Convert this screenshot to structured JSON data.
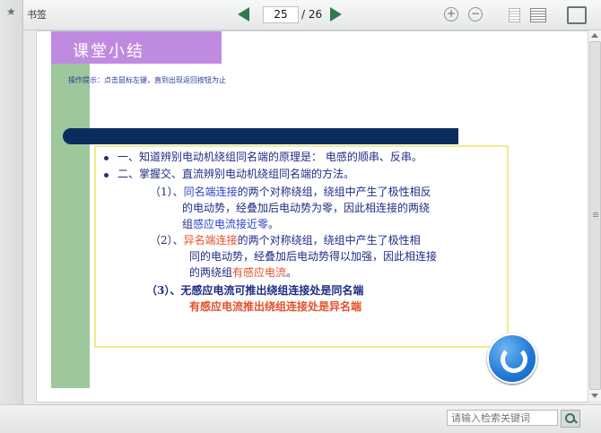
{
  "toolbar": {
    "bookmark_label": "书签",
    "current_page": "25",
    "total_pages": "/ 26",
    "zoom_in": "+",
    "zoom_out": "−"
  },
  "slide": {
    "title": "课堂小结",
    "tip": "操作提示：点击鼠标左键，直到出现返回按钮为止",
    "line1": "一、知道辨别电动机绕组同名端的原理是：    电感的顺串、反串。",
    "line2": "二、掌握交、直流辨别电动机绕组同名端的方法。",
    "p1_prefix": "（1）、",
    "p1_key": "同名端连接",
    "p1_rest": "的两个对称绕组，绕组中产生了极性相反",
    "p1_l2": "的电动势，经叠加后电动势为零，因此相连接的两绕",
    "p1_l3a": "组",
    "p1_l3b": "感应电流接近零",
    "p1_l3c": "。",
    "p2_prefix": "（2）、",
    "p2_key": "异名端连接",
    "p2_rest": "的两个对称绕组，绕组中产生了极性相",
    "p2_l2": "同的电动势，经叠加后电动势得以加强，因此相连接",
    "p2_l3a": "的两绕组",
    "p2_l3b": "有感应电流",
    "p2_l3c": "。",
    "p3_l1": "（3）、无感应电流可推出绕组连接处是同名端",
    "p3_l2": "有感应电流推出绕组连接处是异名端"
  },
  "search": {
    "placeholder": "请输入检索关键词"
  },
  "colors": {
    "accent_red": "#e5502a",
    "text_blue": "#1f2d85",
    "title_purple": "#c08ae0",
    "side_green": "#9ec89c"
  }
}
